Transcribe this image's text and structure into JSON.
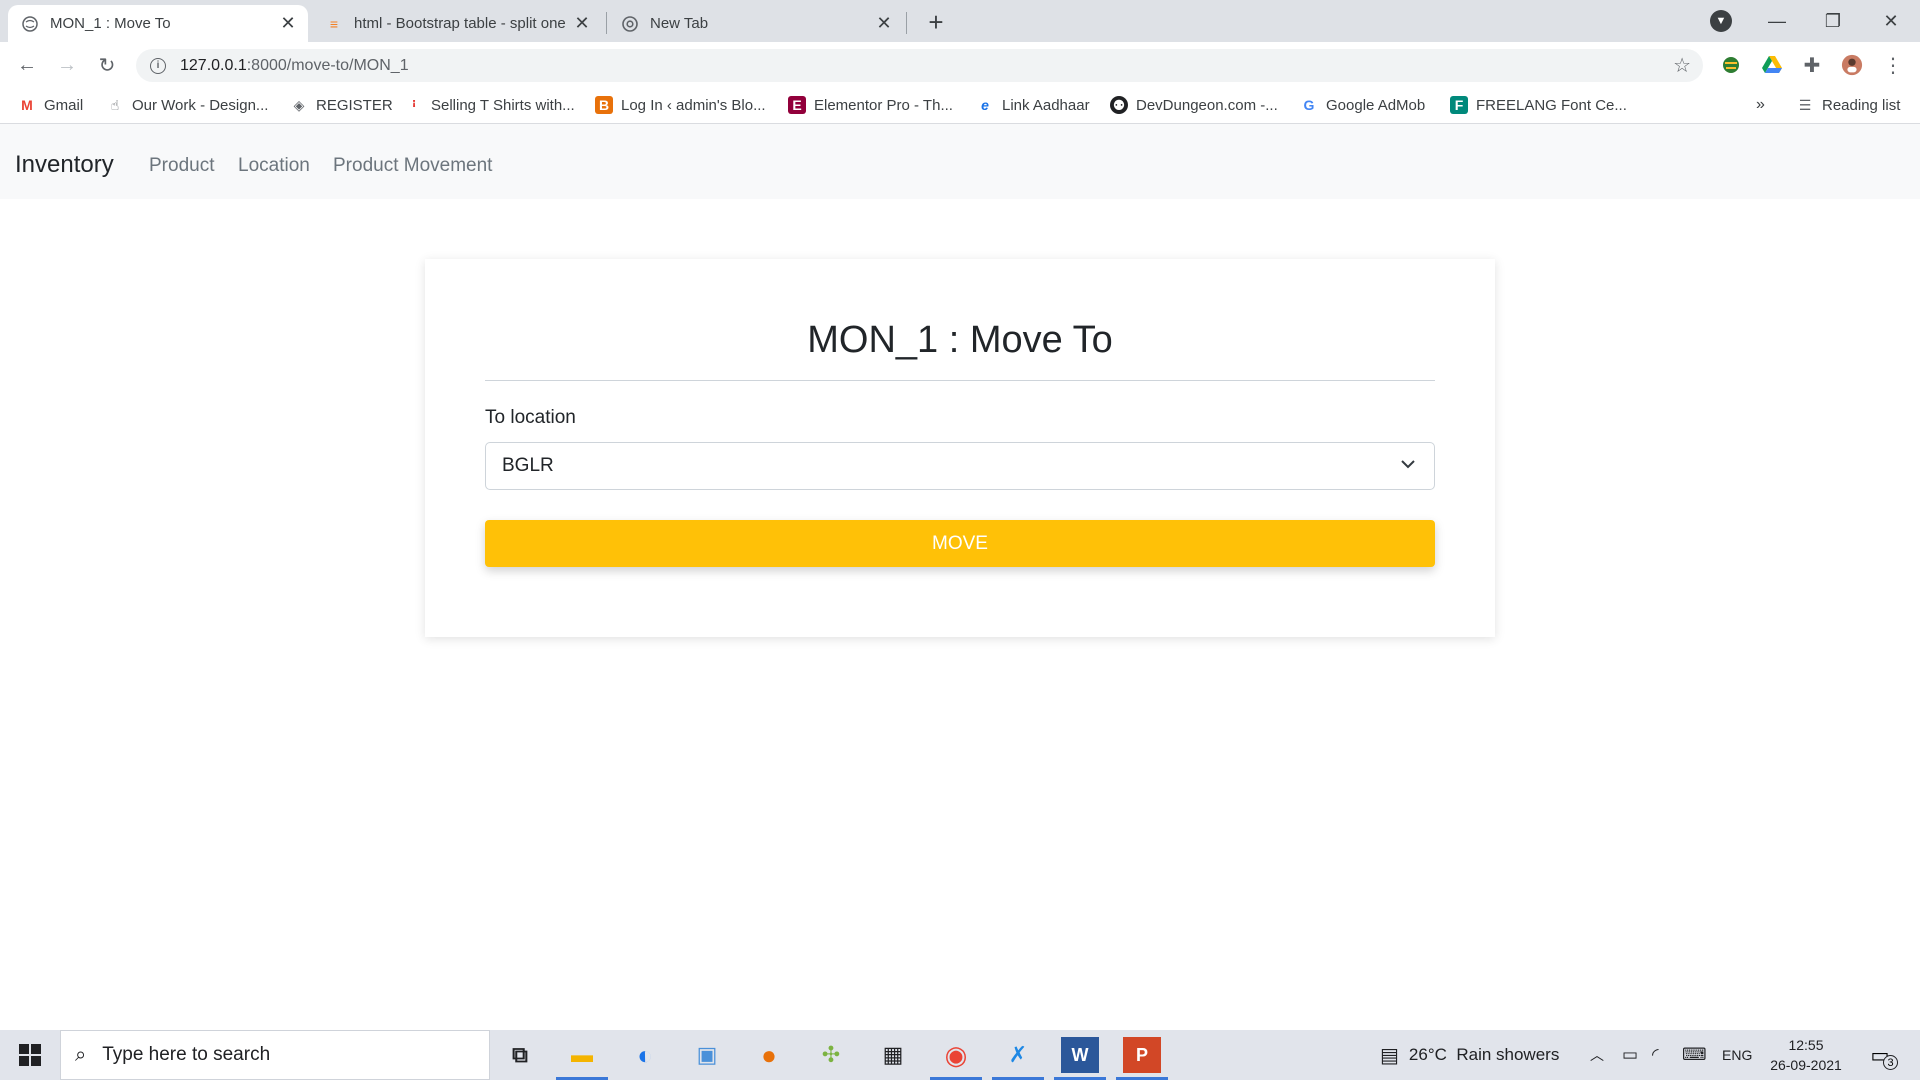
{
  "browser": {
    "tabs": [
      {
        "title": "MON_1 : Move To",
        "active": true
      },
      {
        "title": "html - Bootstrap table - split one",
        "active": false
      },
      {
        "title": "New Tab",
        "active": false
      }
    ],
    "url": {
      "host": "127.0.0.1",
      "path": ":8000/move-to/MON_1"
    },
    "bookmarks": [
      {
        "label": "Gmail",
        "icon": "gmail-icon"
      },
      {
        "label": "Our Work - Design...",
        "icon": "hand-icon"
      },
      {
        "label": "REGISTER",
        "icon": "register-icon"
      },
      {
        "label": "Selling T Shirts with...",
        "icon": "teespring-icon"
      },
      {
        "label": "Log In ‹ admin's Blo...",
        "icon": "blog-icon"
      },
      {
        "label": "Elementor Pro - Th...",
        "icon": "elementor-icon"
      },
      {
        "label": "Link Aadhaar",
        "icon": "edge-icon"
      },
      {
        "label": "DevDungeon.com -...",
        "icon": "github-icon"
      },
      {
        "label": "Google AdMob",
        "icon": "google-icon"
      },
      {
        "label": "FREELANG Font Ce...",
        "icon": "freelang-icon"
      }
    ],
    "more_bookmarks": "»",
    "reading_list": "Reading list"
  },
  "app": {
    "brand": "Inventory",
    "nav": [
      "Product",
      "Location",
      "Product Movement"
    ],
    "card_title": "MON_1 : Move To",
    "field_label": "To location",
    "selected_location": "BGLR",
    "move_button": "MOVE"
  },
  "taskbar": {
    "search_placeholder": "Type here to search",
    "weather": "26°C  Rain showers",
    "language": "ENG",
    "time": "12:55",
    "date": "26-09-2021",
    "notification_count": "3"
  },
  "colors": {
    "accent": "#ffc107",
    "navbar_bg": "#f8f9fa",
    "tabstrip_bg": "#dee1e6"
  }
}
